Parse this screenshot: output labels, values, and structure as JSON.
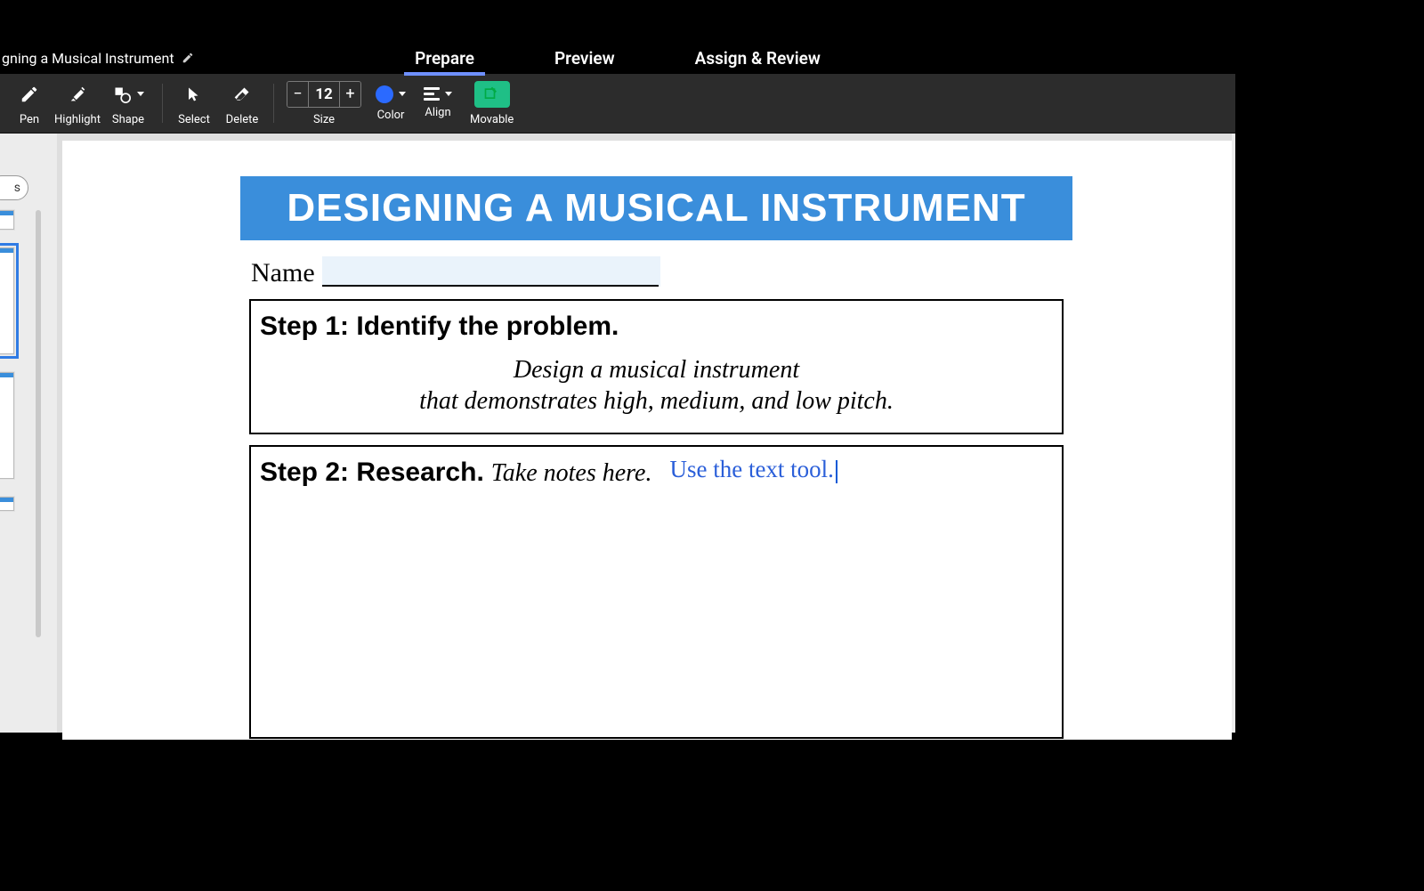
{
  "header": {
    "doc_title": "gning a Musical Instrument",
    "tabs": {
      "prepare": "Prepare",
      "preview": "Preview",
      "assign": "Assign & Review"
    }
  },
  "toolbar": {
    "pen": "Pen",
    "highlight": "Highlight",
    "shape": "Shape",
    "select": "Select",
    "delete": "Delete",
    "size_label": "Size",
    "size_value": "12",
    "color_label": "Color",
    "color_value": "#2b6aff",
    "align_label": "Align",
    "movable_label": "Movable"
  },
  "side": {
    "pill": "s"
  },
  "document": {
    "banner": "DESIGNING A MUSICAL INSTRUMENT",
    "name_label": "Name",
    "step1_title": "Step 1: Identify the problem.",
    "step1_prompt_line1": "Design a musical instrument",
    "step1_prompt_line2": "that demonstrates high, medium, and low pitch.",
    "step2_bold": "Step 2: Research.",
    "step2_ital": "Take notes here.",
    "placed_text": "Use the text tool."
  }
}
